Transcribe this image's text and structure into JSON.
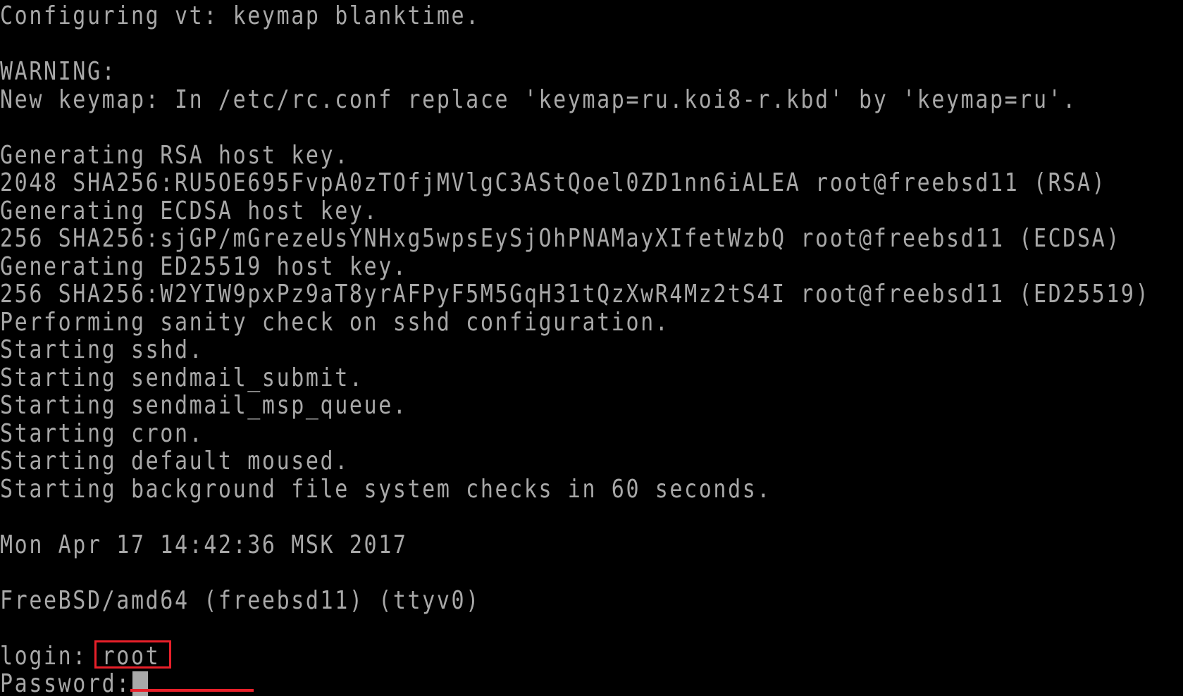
{
  "terminal": {
    "text_color": "#a8a8a8",
    "background_color": "#000000",
    "lines": [
      "Configuring vt: keymap blanktime.",
      "",
      "WARNING:",
      "New keymap: In /etc/rc.conf replace 'keymap=ru.koi8-r.kbd' by 'keymap=ru'.",
      "",
      "Generating RSA host key.",
      "2048 SHA256:RU5OE695FvpA0zTOfjMVlgC3AStQoel0ZD1nn6iALEA root@freebsd11 (RSA)",
      "Generating ECDSA host key.",
      "256 SHA256:sjGP/mGrezeUsYNHxg5wpsEySjOhPNAMayXIfetWzbQ root@freebsd11 (ECDSA)",
      "Generating ED25519 host key.",
      "256 SHA256:W2YIW9pxPz9aT8yrAFPyF5M5GqH31tQzXwR4Mz2tS4I root@freebsd11 (ED25519)",
      "Performing sanity check on sshd configuration.",
      "Starting sshd.",
      "Starting sendmail_submit.",
      "Starting sendmail_msp_queue.",
      "Starting cron.",
      "Starting default moused.",
      "Starting background file system checks in 60 seconds.",
      "",
      "Mon Apr 17 14:42:36 MSK 2017",
      "",
      "FreeBSD/amd64 (freebsd11) (ttyv0)",
      ""
    ],
    "login": {
      "prompt": "login: ",
      "value": "root"
    },
    "password": {
      "prompt": "Password:",
      "value": ""
    }
  },
  "annotations": {
    "highlight_color": "#e8202a"
  }
}
